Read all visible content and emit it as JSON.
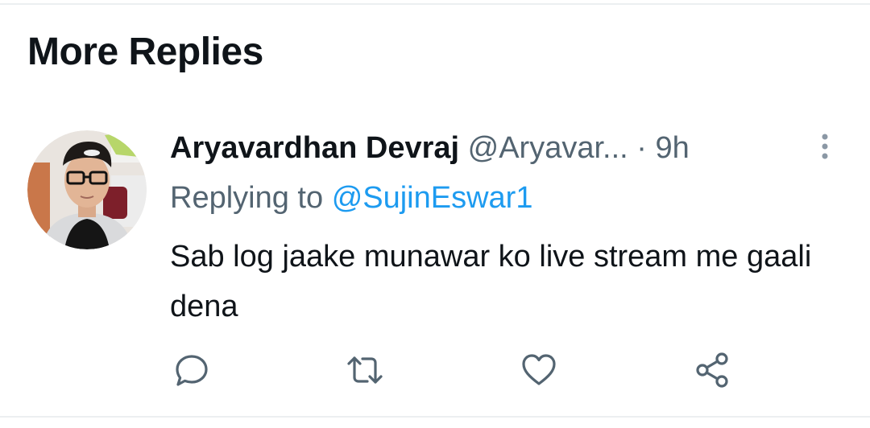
{
  "section": {
    "title": "More Replies"
  },
  "tweet": {
    "author_name": "Aryavardhan Devraj",
    "author_handle": "@Aryavar...",
    "separator": "·",
    "time": "9h",
    "replying_prefix": "Replying to",
    "replying_to": "@SujinEswar1",
    "text": "Sab log jaake munawar ko live stream me gaali dena",
    "avatar_icon": "profile-photo"
  },
  "actions": [
    {
      "name": "reply",
      "icon": "speech-bubble-icon"
    },
    {
      "name": "retweet",
      "icon": "retweet-arrows-icon"
    },
    {
      "name": "like",
      "icon": "heart-icon"
    },
    {
      "name": "share",
      "icon": "share-nodes-icon"
    }
  ],
  "colors": {
    "text_primary": "#0f1419",
    "text_secondary": "#536471",
    "link": "#1d9bf0",
    "divider": "#eceff1"
  }
}
